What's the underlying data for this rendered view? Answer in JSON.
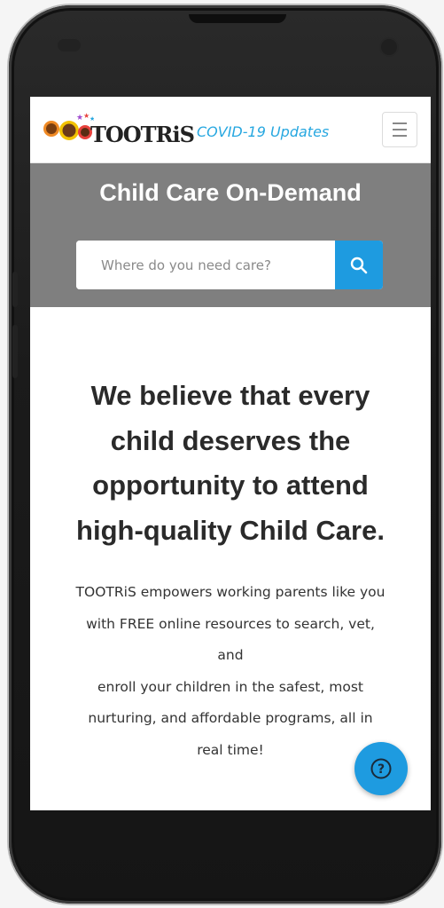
{
  "header": {
    "logo_text": "TOOTRiS",
    "covid_link": "COVID-19 Updates"
  },
  "hero": {
    "title": "Child Care On-Demand",
    "search_placeholder": "Where do you need care?",
    "search_value": ""
  },
  "main": {
    "headline_lines": [
      "We believe that every",
      "child deserves the",
      "opportunity to attend",
      "high-quality Child Care."
    ],
    "body_lines": [
      "TOOTRiS empowers working parents like you",
      "with FREE online resources to search, vet,",
      "and",
      "enroll your children in the safest, most",
      "nurturing, and affordable programs, all in",
      "real time!"
    ]
  },
  "icons": {
    "menu": "hamburger-menu-icon",
    "search": "search-icon",
    "help": "question-mark-icon"
  },
  "colors": {
    "accent": "#1e9be0",
    "link": "#26a7e0",
    "hero_bg": "#7f7f7f"
  }
}
